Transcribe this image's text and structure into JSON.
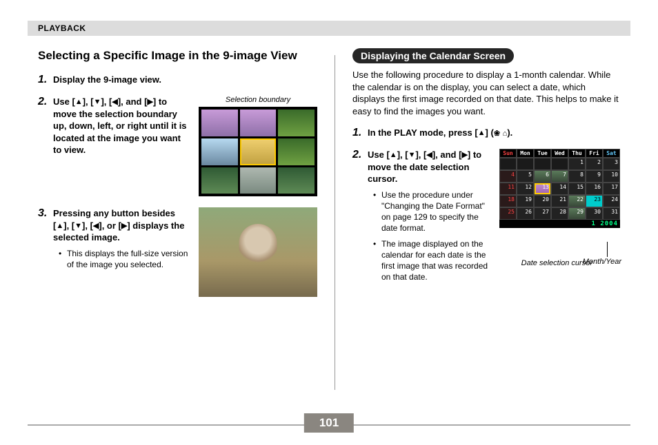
{
  "header": {
    "section": "PLAYBACK"
  },
  "page_number": "101",
  "left": {
    "title": "Selecting a Specific Image in the 9-image View",
    "step1": {
      "text": "Display the 9-image view."
    },
    "step2": {
      "text_before": "Use [",
      "text_mid1": "], [",
      "text_mid2": "], [",
      "text_mid3": "], and [",
      "text_after": "] to move the selection boundary up, down, left, or right until it is located at the image you want to view.",
      "caption": "Selection boundary"
    },
    "step3": {
      "text_before": "Pressing any button besides [",
      "text_mid1": "], [",
      "text_mid2": "], [",
      "text_mid3": "], or [",
      "text_after": "] displays the selected image.",
      "bullet": "This displays the full-size version of the image you selected."
    }
  },
  "right": {
    "pill": "Displaying the Calendar Screen",
    "intro": "Use the following procedure to display a 1-month calendar. While the calendar is on the display, you can select a date, which displays the first image recorded on that date. This helps to make it easy to find the images you want.",
    "step1": {
      "text_before": "In the PLAY mode, press [",
      "text_after": "] (",
      "text_close": ")."
    },
    "step2": {
      "text_before": "Use [",
      "text_mid1": "], [",
      "text_mid2": "], [",
      "text_mid3": "], and [",
      "text_after": "] to move the date selection cursor.",
      "bullet1": "Use the procedure under \"Changing the Date Format\" on page 129 to specify the date format.",
      "bullet2": "The image displayed on the calendar for each date is the first image that was recorded on that date."
    },
    "calendar": {
      "days": [
        "Sun",
        "Mon",
        "Tue",
        "Wed",
        "Thu",
        "Fri",
        "Sat"
      ],
      "month_year": "1  2004",
      "label_my": "Month/Year",
      "label_cursor": "Date selection cursor"
    }
  },
  "icons": {
    "up": "▲",
    "down": "▼",
    "left": "◀",
    "right": "▶",
    "flower": "❀",
    "plant": "⌂"
  }
}
